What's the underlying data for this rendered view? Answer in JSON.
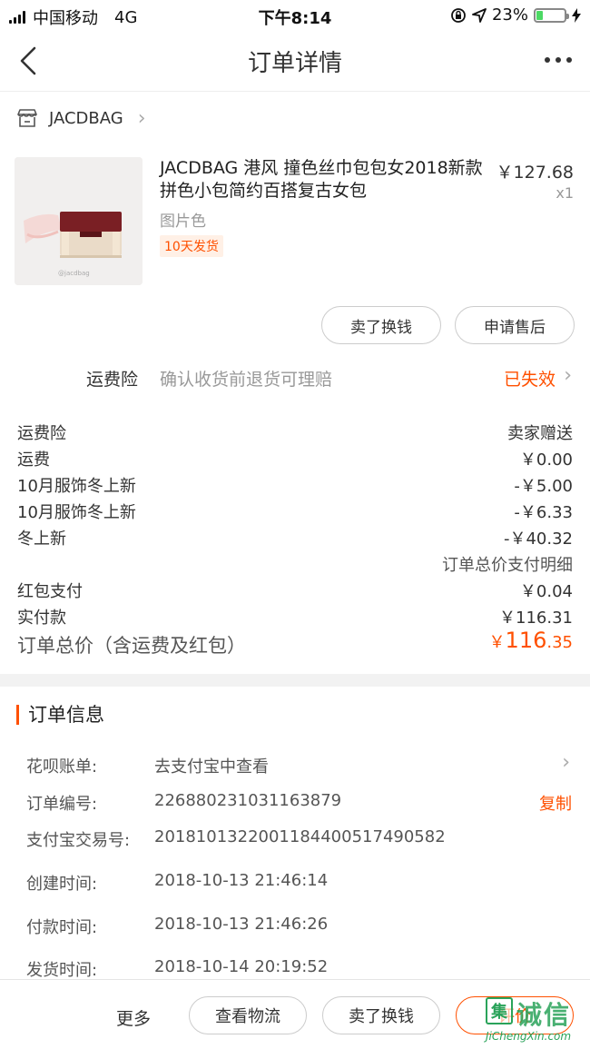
{
  "status_bar": {
    "carrier": "中国移动",
    "network": "4G",
    "time": "下午8:14",
    "battery": "23%",
    "battery_level": 0.23
  },
  "nav": {
    "title": "订单详情"
  },
  "shop": {
    "name": "JACDBAG"
  },
  "product": {
    "title": "JACDBAG 港风 撞色丝巾包包女2018新款拼色小包简约百搭复古女包",
    "price": "￥127.68",
    "qty": "x1",
    "variant": "图片色",
    "badge": "10天发货",
    "image_caption": "@jacdbag"
  },
  "item_actions": {
    "sell": "卖了换钱",
    "after_sale": "申请售后"
  },
  "shipping_insurance": {
    "label": "运费险",
    "description": "确认收货前退货可理赔",
    "status": "已失效"
  },
  "cost_rows": [
    {
      "label": "运费险",
      "value": "卖家赠送"
    },
    {
      "label": "运费",
      "value": "￥0.00"
    },
    {
      "label": "10月服饰冬上新",
      "value": "-￥5.00"
    },
    {
      "label": "10月服饰冬上新",
      "value": "-￥6.33"
    },
    {
      "label": "冬上新",
      "value": "-￥40.32"
    }
  ],
  "payment_detail_link": "订单总价支付明细",
  "payment_rows": [
    {
      "label": "红包支付",
      "value": "￥0.04"
    },
    {
      "label": "实付款",
      "value": "￥116.31"
    }
  ],
  "total": {
    "label": "订单总价（含运费及红包）",
    "currency": "￥",
    "integer": "116",
    "decimal": ".35"
  },
  "order_info": {
    "heading": "订单信息",
    "rows": [
      {
        "label": "花呗账单:",
        "value": "去支付宝中查看"
      },
      {
        "label": "订单编号:",
        "value": "226880231031163879",
        "action": "复制"
      },
      {
        "label": "支付宝交易号:",
        "value": "2018101322001184400517490582"
      },
      {
        "label": "创建时间:",
        "value": "2018-10-13 21:46:14"
      },
      {
        "label": "付款时间:",
        "value": "2018-10-13 21:46:26"
      },
      {
        "label": "发货时间:",
        "value": "2018-10-14 20:19:52"
      }
    ]
  },
  "bottom_bar": {
    "more": "更多",
    "logistics": "查看物流",
    "sell": "卖了换钱",
    "review": "评价"
  },
  "watermark": {
    "mark": "集",
    "text": "诚信",
    "url": "JiChengXin.com"
  }
}
